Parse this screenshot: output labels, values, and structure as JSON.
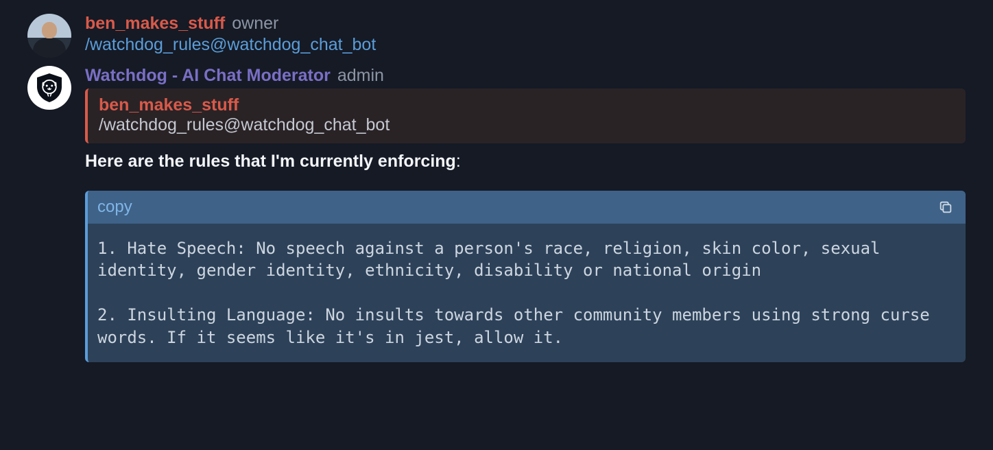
{
  "message1": {
    "username": "ben_makes_stuff",
    "role": "owner",
    "command": "/watchdog_rules@watchdog_chat_bot"
  },
  "message2": {
    "username": "Watchdog - AI Chat Moderator",
    "role": "admin",
    "reply": {
      "username": "ben_makes_stuff",
      "command": "/watchdog_rules@watchdog_chat_bot"
    },
    "body_prefix": "Here are the rules that I'm currently enforcing",
    "body_suffix": ":",
    "code": {
      "copy_label": "copy",
      "content": "1. Hate Speech: No speech against a person's race, religion, skin color, sexual identity, gender identity, ethnicity, disability or national origin\n\n2. Insulting Language: No insults towards other community members using strong curse words. If it seems like it's in jest, allow it."
    }
  }
}
